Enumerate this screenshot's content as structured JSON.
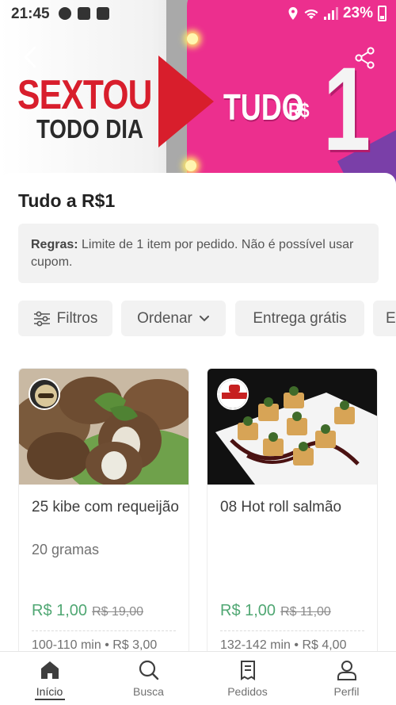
{
  "status_bar": {
    "time": "21:45",
    "battery": "23%"
  },
  "banner": {
    "headline": "SEXTOU",
    "subline": "TODO DIA",
    "offer_word": "TUDO",
    "currency": "R$",
    "offer_value": "1"
  },
  "page": {
    "title": "Tudo a R$1",
    "rules_label": "Regras:",
    "rules_text": " Limite de 1 item por pedido. Não é possível usar cupom."
  },
  "filters": {
    "filters_label": "Filtros",
    "sort_label": "Ordenar",
    "free_delivery_label": "Entrega grátis",
    "next_chip_label": "E"
  },
  "products": [
    {
      "name": "25 kibe com requeijão",
      "detail": "20 gramas",
      "price": "R$ 1,00",
      "old_price": "R$ 19,00",
      "meta": "100-110 min • R$ 3,00"
    },
    {
      "name": "08 Hot roll salmão",
      "detail": "",
      "price": "R$ 1,00",
      "old_price": "R$ 11,00",
      "meta": "132-142 min • R$ 4,00"
    }
  ],
  "nav": {
    "home": "Início",
    "search": "Busca",
    "orders": "Pedidos",
    "profile": "Perfil"
  },
  "colors": {
    "price_green": "#50a773",
    "banner_red": "#d81e2c",
    "banner_pink": "#ec2f8e"
  }
}
